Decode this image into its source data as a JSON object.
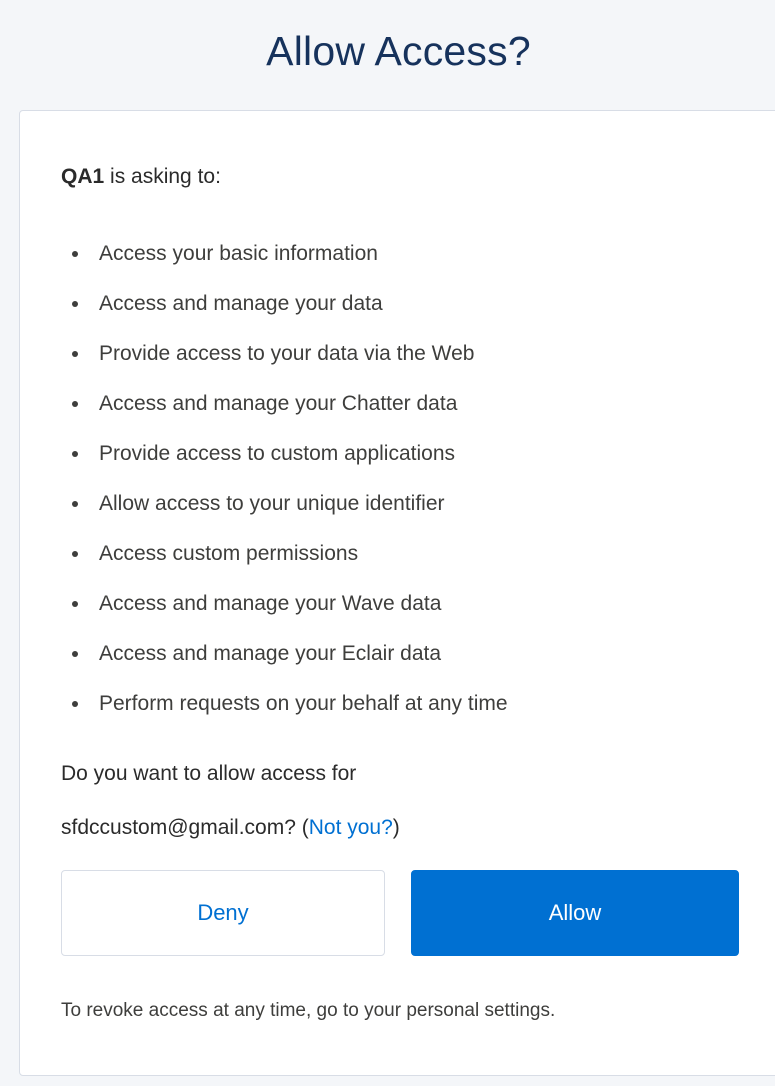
{
  "header": {
    "title": "Allow Access?"
  },
  "intro": {
    "app_name": "QA1",
    "text": "is asking to:"
  },
  "scopes": [
    "Access your basic information",
    "Access and manage your data",
    "Provide access to your data via the Web",
    "Access and manage your Chatter data",
    "Provide access to custom applications",
    "Allow access to your unique identifier",
    "Access custom permissions",
    "Access and manage your Wave data",
    "Access and manage your Eclair data",
    "Perform requests on your behalf at any time"
  ],
  "question": {
    "line1": "Do you want to allow access for",
    "email": "sfdccustom@gmail.com?",
    "open_paren": "(",
    "not_you": "Not you?",
    "close_paren": ")"
  },
  "actions": {
    "deny_label": "Deny",
    "allow_label": "Allow"
  },
  "footer": {
    "note": "To revoke access at any time, go to your personal settings."
  },
  "colors": {
    "brand": "#0070d2",
    "title": "#16325c",
    "background": "#f4f6f9"
  }
}
